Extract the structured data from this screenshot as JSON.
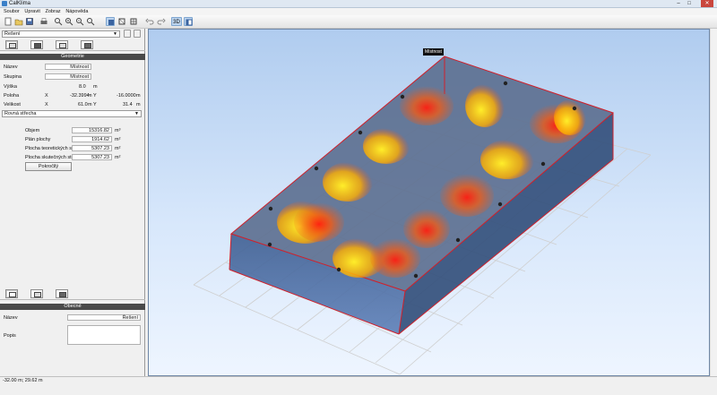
{
  "window": {
    "title": "CalKlima",
    "min": "–",
    "max": "□",
    "close": "✕"
  },
  "menu": [
    "Soubor",
    "Upravit",
    "Zobraz",
    "Nápověda"
  ],
  "left": {
    "selector": "Řešení",
    "geometry_header": "Geometrie",
    "fields": {
      "nazev_label": "Název",
      "nazev_value": "Místnost",
      "skupina_label": "Skupina",
      "skupina_value": "Místnost",
      "vyska_label": "Výška",
      "vyska_value": "8.0",
      "vyska_unit": "m",
      "poloha_label": "Poloha",
      "poloha_x_label": "X",
      "poloha_x": "-32.3994",
      "poloha_y_label": "m Y",
      "poloha_y": "-16.0000",
      "poloha_unit": "m",
      "velikost_label": "Velikost",
      "velikost_x_label": "X",
      "velikost_x": "61.0",
      "velikost_y_label": "m Y",
      "velikost_y": "31.4",
      "velikost_unit": "m"
    },
    "roof_select": "Rovná střecha",
    "stats": {
      "objem_label": "Objem",
      "objem_value": "15316.82",
      "objem_unit": "m³",
      "plan_label": "Plán plochy",
      "plan_value": "1914.62",
      "plan_unit": "m²",
      "teor_label": "Plocha teoretických stěn",
      "teor_value": "5307.23",
      "teor_unit": "m²",
      "skut_label": "Plocha skutečných stěn",
      "skut_value": "5307.23",
      "skut_unit": "m²"
    },
    "advanced_button": "Pokročilý",
    "general_header": "Obecné",
    "nazev2_label": "Název",
    "nazev2_value": "Řešení",
    "popis_label": "Popis"
  },
  "viewport": {
    "room_label": "Místnost"
  },
  "status": "-32.00 m; 29.62 m",
  "colors": {
    "accent": "#bcd4ee",
    "room_wall": "#2d4f86",
    "edge": "#d0202a"
  }
}
